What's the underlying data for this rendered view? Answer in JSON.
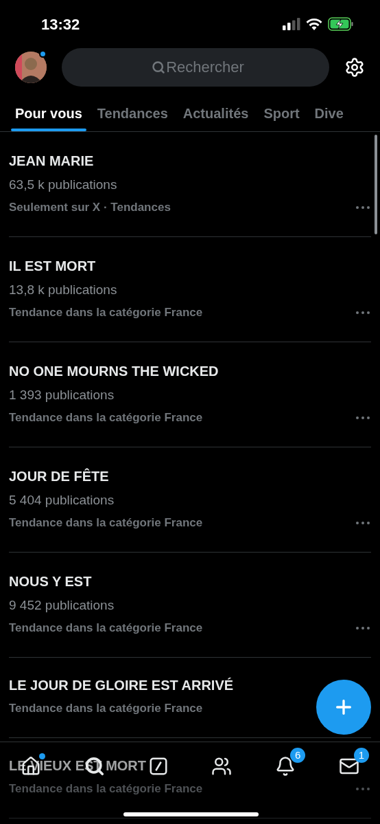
{
  "status_bar": {
    "time": "13:32",
    "charging": true
  },
  "header": {
    "avatar_notification": true,
    "search": {
      "placeholder": "Rechercher"
    }
  },
  "tabs": [
    {
      "label": "Pour vous",
      "selected": true
    },
    {
      "label": "Tendances",
      "selected": false
    },
    {
      "label": "Actualités",
      "selected": false
    },
    {
      "label": "Sport",
      "selected": false
    },
    {
      "label": "Dive",
      "selected": false
    }
  ],
  "trends": [
    {
      "title": "JEAN MARIE",
      "count": "63,5 k publications",
      "context": "Seulement sur X · Tendances"
    },
    {
      "title": "IL EST MORT",
      "count": "13,8 k publications",
      "context": "Tendance dans la catégorie France"
    },
    {
      "title": "NO ONE MOURNS THE WICKED",
      "count": "1 393 publications",
      "context": "Tendance dans la catégorie France"
    },
    {
      "title": "JOUR DE FÊTE",
      "count": "5 404 publications",
      "context": "Tendance dans la catégorie France"
    },
    {
      "title": "NOUS Y EST",
      "count": "9 452 publications",
      "context": "Tendance dans la catégorie France"
    },
    {
      "title": "LE JOUR DE GLOIRE EST ARRIVÉ",
      "context": "Tendance dans la catégorie France"
    },
    {
      "title": "LE VIEUX EST MORT",
      "context": "Tendance dans la catégorie France"
    }
  ],
  "nav": [
    {
      "kind": "home",
      "dot": true
    },
    {
      "kind": "search"
    },
    {
      "kind": "grok"
    },
    {
      "kind": "communities"
    },
    {
      "kind": "notifications",
      "badge": "6"
    },
    {
      "kind": "messages",
      "badge": "1"
    }
  ]
}
